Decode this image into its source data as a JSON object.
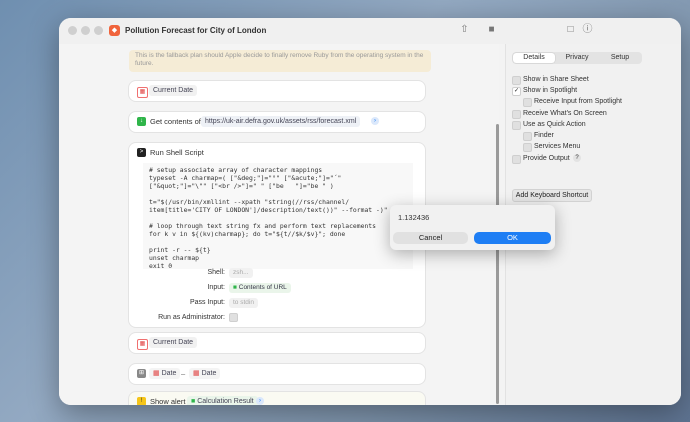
{
  "window": {
    "title": "Pollution Forecast for City of London"
  },
  "ghost_text": "This is the fallback plan should Apple decide to finally remove Ruby from the operating system in the future.",
  "actions": {
    "current_date_1": {
      "label": "Current Date"
    },
    "get_contents": {
      "label": "Get contents of",
      "url": "https://uk-air.defra.gov.uk/assets/rss/forecast.xml"
    },
    "shell": {
      "label": "Run Shell Script",
      "code": "# setup associate array of character mappings\ntypeset -A charmap=( [\"&deg;\"]=\"°\" [\"&acute;\"]=\"´\"\n[\"&quot;\"]=\"\\\"\" [\"<br />\"]=\" \" [\"be   \"]=\"be \" )\n\nt=\"$(/usr/bin/xmllint --xpath \"string(//rss/channel/\nitem[title='CITY OF LONDON']/description/text())\" --format -)\"\n\n# loop through text string fx and perform text replacements\nfor k v in ${(kv)charmap}; do t=\"${t//$k/$v}\"; done\n\nprint -r -- ${t}\nunset charmap\nexit 0",
      "shell_label": "Shell:",
      "shell_value": "zsh...",
      "input_label": "Input:",
      "input_value": "Contents of URL",
      "pass_label": "Pass Input:",
      "pass_value": "to stdin",
      "admin_label": "Run as Administrator:"
    },
    "current_date_2": {
      "label": "Current Date"
    },
    "date_compare": {
      "a": "Date",
      "b": "Date"
    },
    "alert": {
      "label": "Show alert",
      "value": "Calculation Result"
    }
  },
  "sidebar": {
    "tabs": [
      "Details",
      "Privacy",
      "Setup"
    ],
    "options": [
      {
        "label": "Show in Share Sheet",
        "checked": false
      },
      {
        "label": "Show in Spotlight",
        "checked": true
      },
      {
        "label": "Receive Input from Spotlight",
        "checked": false
      },
      {
        "label": "Receive What's On Screen",
        "checked": false
      },
      {
        "label": "Use as Quick Action",
        "checked": false
      },
      {
        "label": "Finder",
        "checked": false
      },
      {
        "label": "Services Menu",
        "checked": false
      },
      {
        "label": "Provide Output",
        "checked": false
      }
    ],
    "shortcut_button": "Add Keyboard Shortcut"
  },
  "popup": {
    "value": "1.132436",
    "cancel": "Cancel",
    "ok": "OK"
  },
  "colors": {
    "accent": "#1e7ef4",
    "app_icon": "#f0643c"
  }
}
